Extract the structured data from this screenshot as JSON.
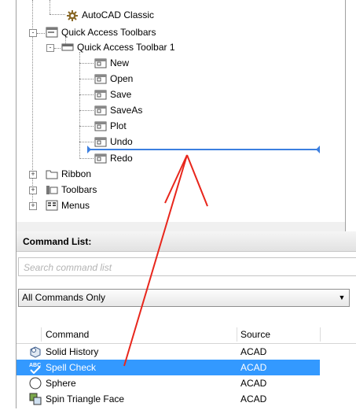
{
  "tree": {
    "items": [
      {
        "label": "AutoCAD Classic",
        "icon": "gear-icon"
      },
      {
        "label": "Quick Access Toolbars",
        "icon": "toolbar-group-icon",
        "expander": "-"
      },
      {
        "label": "Quick Access Toolbar 1",
        "icon": "toolbar-icon",
        "expander": "-"
      },
      {
        "label": "New",
        "icon": "command-icon"
      },
      {
        "label": "Open",
        "icon": "command-icon"
      },
      {
        "label": "Save",
        "icon": "command-icon"
      },
      {
        "label": "SaveAs",
        "icon": "command-icon"
      },
      {
        "label": "Plot",
        "icon": "command-icon"
      },
      {
        "label": "Undo",
        "icon": "command-icon"
      },
      {
        "label": "Redo",
        "icon": "command-icon"
      },
      {
        "label": "Ribbon",
        "icon": "folder-icon",
        "expander": "+"
      },
      {
        "label": "Toolbars",
        "icon": "toolbars-icon",
        "expander": "+"
      },
      {
        "label": "Menus",
        "icon": "menus-icon",
        "expander": "+"
      }
    ]
  },
  "command_list": {
    "title": "Command List:",
    "search_placeholder": "Search command list",
    "filter_value": "All Commands Only",
    "columns": {
      "command": "Command",
      "source": "Source"
    },
    "rows": [
      {
        "command": "Solid History",
        "source": "ACAD",
        "icon": "solid-history-icon",
        "selected": false
      },
      {
        "command": "Spell Check",
        "source": "ACAD",
        "icon": "spell-check-icon",
        "selected": true
      },
      {
        "command": "Sphere",
        "source": "ACAD",
        "icon": "sphere-icon",
        "selected": false
      },
      {
        "command": "Spin Triangle Face",
        "source": "ACAD",
        "icon": "spin-triangle-icon",
        "selected": false
      }
    ]
  },
  "colors": {
    "selection": "#3399ff",
    "drop_indicator": "#3c7fe0",
    "annotation_arrow": "#e8261c"
  }
}
